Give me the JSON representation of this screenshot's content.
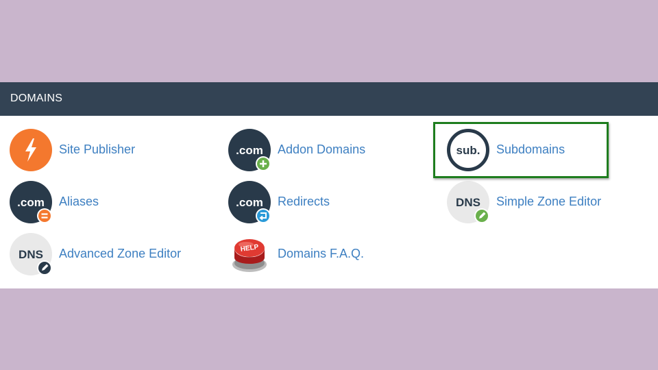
{
  "panel": {
    "title": "DOMAINS"
  },
  "items": [
    {
      "label": "Site Publisher",
      "icon": "lightning-bolt-icon"
    },
    {
      "label": "Addon Domains",
      "icon": "dotcom-add-icon",
      "icon_text": ".com"
    },
    {
      "label": "Subdomains",
      "icon": "sub-icon",
      "icon_text": "sub."
    },
    {
      "label": "Aliases",
      "icon": "dotcom-alias-icon",
      "icon_text": ".com"
    },
    {
      "label": "Redirects",
      "icon": "dotcom-redirect-icon",
      "icon_text": ".com"
    },
    {
      "label": "Simple Zone Editor",
      "icon": "dns-edit-icon",
      "icon_text": "DNS"
    },
    {
      "label": "Advanced Zone Editor",
      "icon": "dns-advanced-edit-icon",
      "icon_text": "DNS"
    },
    {
      "label": "Domains F.A.Q.",
      "icon": "help-button-icon",
      "icon_text": "HELP"
    }
  ],
  "colors": {
    "background": "#c9b5cc",
    "header": "#334354",
    "link": "#3d7fc1",
    "orange": "#f4782e",
    "dark_circle": "#293a4a",
    "green_badge": "#6ab04c",
    "blue_badge": "#2a9ad8",
    "highlight_border": "#1e7d1e"
  }
}
